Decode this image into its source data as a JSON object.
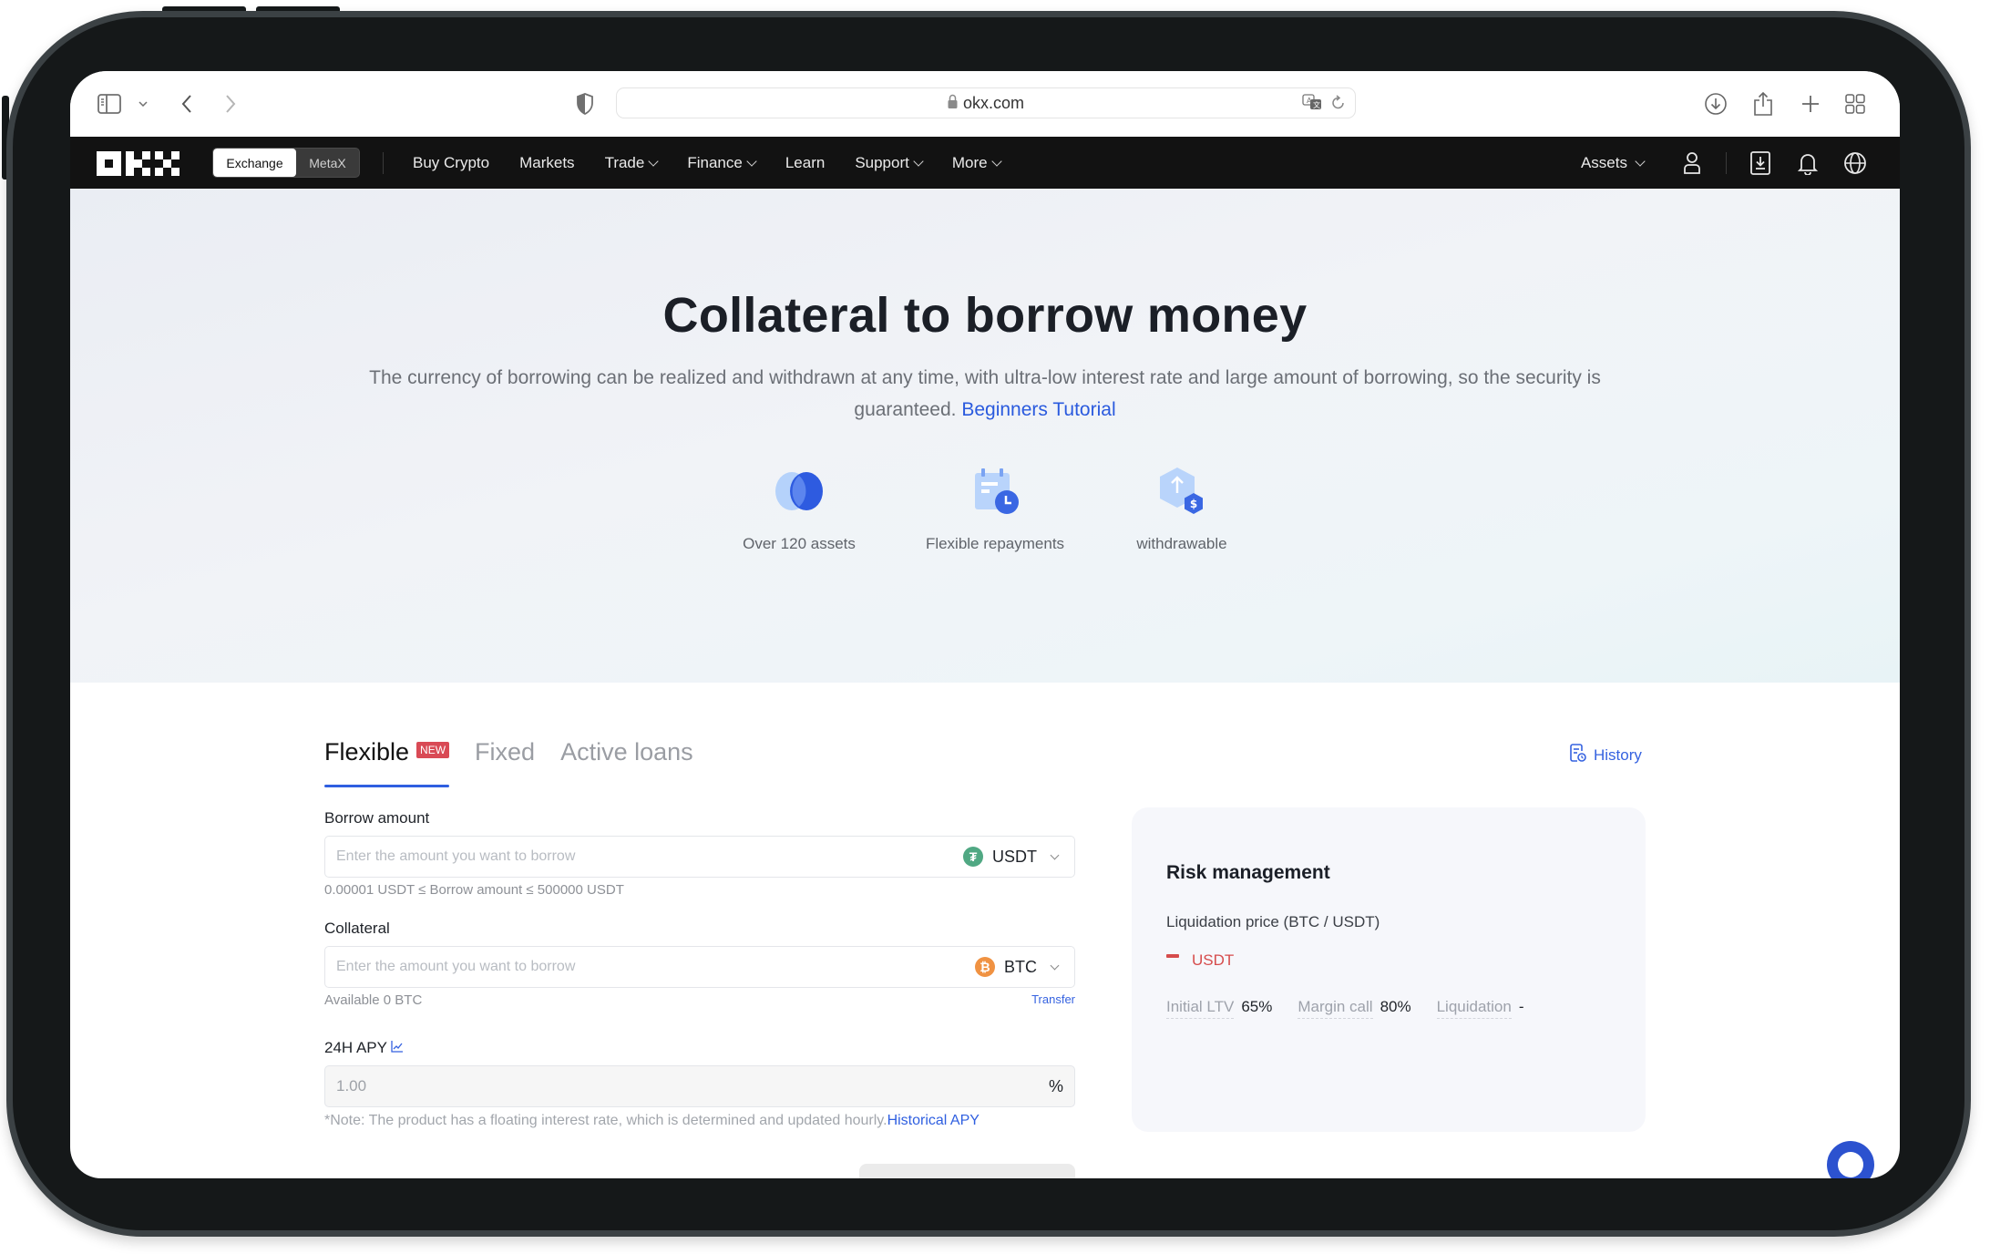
{
  "browser": {
    "url": "okx.com",
    "icons": [
      "sidebar-icon",
      "chevron-down-icon",
      "back-icon",
      "forward-icon",
      "shield-icon",
      "lock-icon",
      "translate-icon",
      "reload-icon",
      "download-icon",
      "share-icon",
      "new-tab-icon",
      "tab-overview-icon"
    ]
  },
  "nav": {
    "logo": "OKX",
    "switch": {
      "active": "Exchange",
      "inactive": "MetaX"
    },
    "items": [
      {
        "label": "Buy Crypto",
        "dropdown": false
      },
      {
        "label": "Markets",
        "dropdown": false
      },
      {
        "label": "Trade",
        "dropdown": true
      },
      {
        "label": "Finance",
        "dropdown": true
      },
      {
        "label": "Learn",
        "dropdown": false
      },
      {
        "label": "Support",
        "dropdown": true
      },
      {
        "label": "More",
        "dropdown": true
      }
    ],
    "assets_label": "Assets",
    "right_icons": [
      "user-icon",
      "download-app-icon",
      "bell-icon",
      "globe-icon"
    ]
  },
  "hero": {
    "title": "Collateral to borrow money",
    "subtitle": "The currency of borrowing can be realized and withdrawn at any time, with ultra-low interest rate and large amount of borrowing, so the security is guaranteed.",
    "tutorial_link": "Beginners Tutorial",
    "features": [
      {
        "icon": "assets-icon",
        "label": "Over 120 assets"
      },
      {
        "icon": "calendar-clock-icon",
        "label": "Flexible repayments"
      },
      {
        "icon": "withdraw-icon",
        "label": "withdrawable"
      }
    ]
  },
  "tabs": [
    {
      "label": "Flexible",
      "badge": "NEW",
      "active": true
    },
    {
      "label": "Fixed",
      "active": false
    },
    {
      "label": "Active loans",
      "active": false
    }
  ],
  "history_label": "History",
  "form": {
    "borrow": {
      "label": "Borrow amount",
      "placeholder": "Enter the amount you want to borrow",
      "currency": "USDT",
      "hint": "0.00001 USDT ≤ Borrow amount ≤ 500000 USDT"
    },
    "collateral": {
      "label": "Collateral",
      "placeholder": "Enter the amount you want to borrow",
      "currency": "BTC",
      "available": "Available 0 BTC",
      "transfer": "Transfer"
    },
    "apy": {
      "label": "24H APY",
      "value": "1.00",
      "unit": "%",
      "note": "*Note: The product has a floating interest rate, which is determined and updated hourly.",
      "note_link": "Historical APY"
    }
  },
  "risk": {
    "title": "Risk management",
    "liq_price_label": "Liquidation price (BTC / USDT)",
    "liq_price_value": "USDT",
    "metrics": [
      {
        "label": "Initial LTV",
        "value": "65%"
      },
      {
        "label": "Margin call",
        "value": "80%"
      },
      {
        "label": "Liquidation",
        "value": "-"
      }
    ]
  },
  "colors": {
    "accent": "#2f5fe0",
    "new_badge": "#d94a55",
    "danger": "#d64c4c",
    "usdt": "#50a883",
    "btc": "#f09242"
  }
}
